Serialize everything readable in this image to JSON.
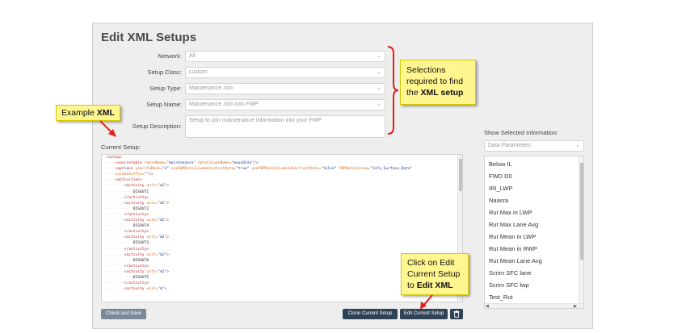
{
  "page": {
    "title": "Edit XML Setups"
  },
  "form": {
    "network": {
      "label": "Network:",
      "value": "All"
    },
    "setup_class": {
      "label": "Setup Class:",
      "value": "custom"
    },
    "setup_type": {
      "label": "Setup Type:",
      "value": "Maintenance Join"
    },
    "setup_name": {
      "label": "Setup Name:",
      "value": "Maintenance Join into FWP"
    },
    "setup_description": {
      "label": "Setup Description:",
      "placeholder": "Setup to join maintenance information into your FWP"
    }
  },
  "current_setup": {
    "label": "Current Setup:",
    "lines": [
      {
        "indent": "  ",
        "parts": [
          [
            "tag",
            "<setup>"
          ]
        ]
      },
      {
        "indent": "      ",
        "parts": [
          [
            "tag",
            "<sourcetable "
          ],
          [
            "attr",
            "tableName="
          ],
          [
            "val",
            "\"maintenance\" "
          ],
          [
            "attr",
            "dateColumnName="
          ],
          [
            "val",
            "\"measDate\""
          ],
          [
            "tag",
            "/>"
          ]
        ]
      },
      {
        "indent": "      ",
        "parts": [
          [
            "tag",
            "<options "
          ],
          [
            "attr",
            "yearsToBack="
          ],
          [
            "val",
            "\"3\" "
          ],
          [
            "attr",
            "useFWPDateColumnAsLatestDate="
          ],
          [
            "val",
            "\"true\" "
          ],
          [
            "attr",
            "useFWPDateColumnAsEarliestDate="
          ],
          [
            "val",
            "\"false\" "
          ],
          [
            "attr",
            "FWPDateColumn="
          ],
          [
            "val",
            "\"Info_Surface_Date\""
          ]
        ]
      },
      {
        "indent": "      ",
        "parts": [
          [
            "attr",
            "columnSuffix="
          ],
          [
            "val",
            "\"\""
          ],
          [
            "tag",
            "/>"
          ]
        ]
      },
      {
        "indent": "      ",
        "parts": [
          [
            "tag",
            "<activities>"
          ]
        ]
      },
      {
        "indent": "          ",
        "parts": [
          [
            "tag",
            "<activity "
          ],
          [
            "attr",
            "unit="
          ],
          [
            "val",
            "\"m2\""
          ],
          [
            "tag",
            ">"
          ]
        ]
      },
      {
        "indent": "              ",
        "parts": [
          [
            "txt",
            "DISOUT1"
          ]
        ]
      },
      {
        "indent": "          ",
        "parts": [
          [
            "tag",
            "</activity>"
          ]
        ]
      },
      {
        "indent": "          ",
        "parts": [
          [
            "tag",
            "<activity "
          ],
          [
            "attr",
            "unit="
          ],
          [
            "val",
            "\"m2\""
          ],
          [
            "tag",
            ">"
          ]
        ]
      },
      {
        "indent": "              ",
        "parts": [
          [
            "txt",
            "DISOUT2"
          ]
        ]
      },
      {
        "indent": "          ",
        "parts": [
          [
            "tag",
            "</activity>"
          ]
        ]
      },
      {
        "indent": "          ",
        "parts": [
          [
            "tag",
            "<activity "
          ],
          [
            "attr",
            "unit="
          ],
          [
            "val",
            "\"m2\""
          ],
          [
            "tag",
            ">"
          ]
        ]
      },
      {
        "indent": "              ",
        "parts": [
          [
            "txt",
            "DISOUT4"
          ]
        ]
      },
      {
        "indent": "          ",
        "parts": [
          [
            "tag",
            "</activity>"
          ]
        ]
      },
      {
        "indent": "          ",
        "parts": [
          [
            "tag",
            "<activity "
          ],
          [
            "attr",
            "unit="
          ],
          [
            "val",
            "\"m2\""
          ],
          [
            "tag",
            ">"
          ]
        ]
      },
      {
        "indent": "              ",
        "parts": [
          [
            "txt",
            "DISOUT3"
          ]
        ]
      },
      {
        "indent": "          ",
        "parts": [
          [
            "tag",
            "</activity>"
          ]
        ]
      },
      {
        "indent": "          ",
        "parts": [
          [
            "tag",
            "<activity "
          ],
          [
            "attr",
            "unit="
          ],
          [
            "val",
            "\"m2\""
          ],
          [
            "tag",
            ">"
          ]
        ]
      },
      {
        "indent": "              ",
        "parts": [
          [
            "txt",
            "DISOUT6"
          ]
        ]
      },
      {
        "indent": "          ",
        "parts": [
          [
            "tag",
            "</activity>"
          ]
        ]
      },
      {
        "indent": "          ",
        "parts": [
          [
            "tag",
            "<activity "
          ],
          [
            "attr",
            "unit="
          ],
          [
            "val",
            "\"m2\""
          ],
          [
            "tag",
            ">"
          ]
        ]
      },
      {
        "indent": "              ",
        "parts": [
          [
            "txt",
            "DISOUT5"
          ]
        ]
      },
      {
        "indent": "          ",
        "parts": [
          [
            "tag",
            "</activity>"
          ]
        ]
      },
      {
        "indent": "          ",
        "parts": [
          [
            "tag",
            "<activity "
          ],
          [
            "attr",
            "unit="
          ],
          [
            "val",
            "\"m\""
          ],
          [
            "tag",
            ">"
          ]
        ]
      }
    ]
  },
  "show_selected": {
    "label": "Show Selected Information:",
    "selected": "Data Parameters",
    "items": [
      "Below IL",
      "FWD D0",
      "IRI_LWP",
      "Naasra",
      "Rut Max in LWP",
      "Rut Max Lane Avg",
      "Rut Mean in LWP",
      "Rut Mean in RWP",
      "Rut Mean Lane Avg",
      "Scrim SFC lane",
      "Scrim SFC lwp",
      "Test_Rut"
    ]
  },
  "buttons": {
    "check_and_save": "Check and Save",
    "clone_current_setup": "Clone Current Setup",
    "edit_current_setup": "Edit Current Setup",
    "delete_icon": "trash-icon"
  },
  "callouts": {
    "selections": {
      "line1": "Selections",
      "line2": "required to find",
      "line3_pre": "the ",
      "line3_bold": "XML setup"
    },
    "example": {
      "pre": "Example ",
      "bold": "XML"
    },
    "edit": {
      "line1": "Click on Edit",
      "line2": "Current Setup",
      "line3_pre": "to ",
      "line3_bold": "Edit XML"
    }
  },
  "colors": {
    "panel_bg": "#eeeeee",
    "button_dark": "#2f4357",
    "button_gray": "#7b8a99",
    "callout_bg": "#fff68f",
    "annotation_red": "#e0201b"
  }
}
